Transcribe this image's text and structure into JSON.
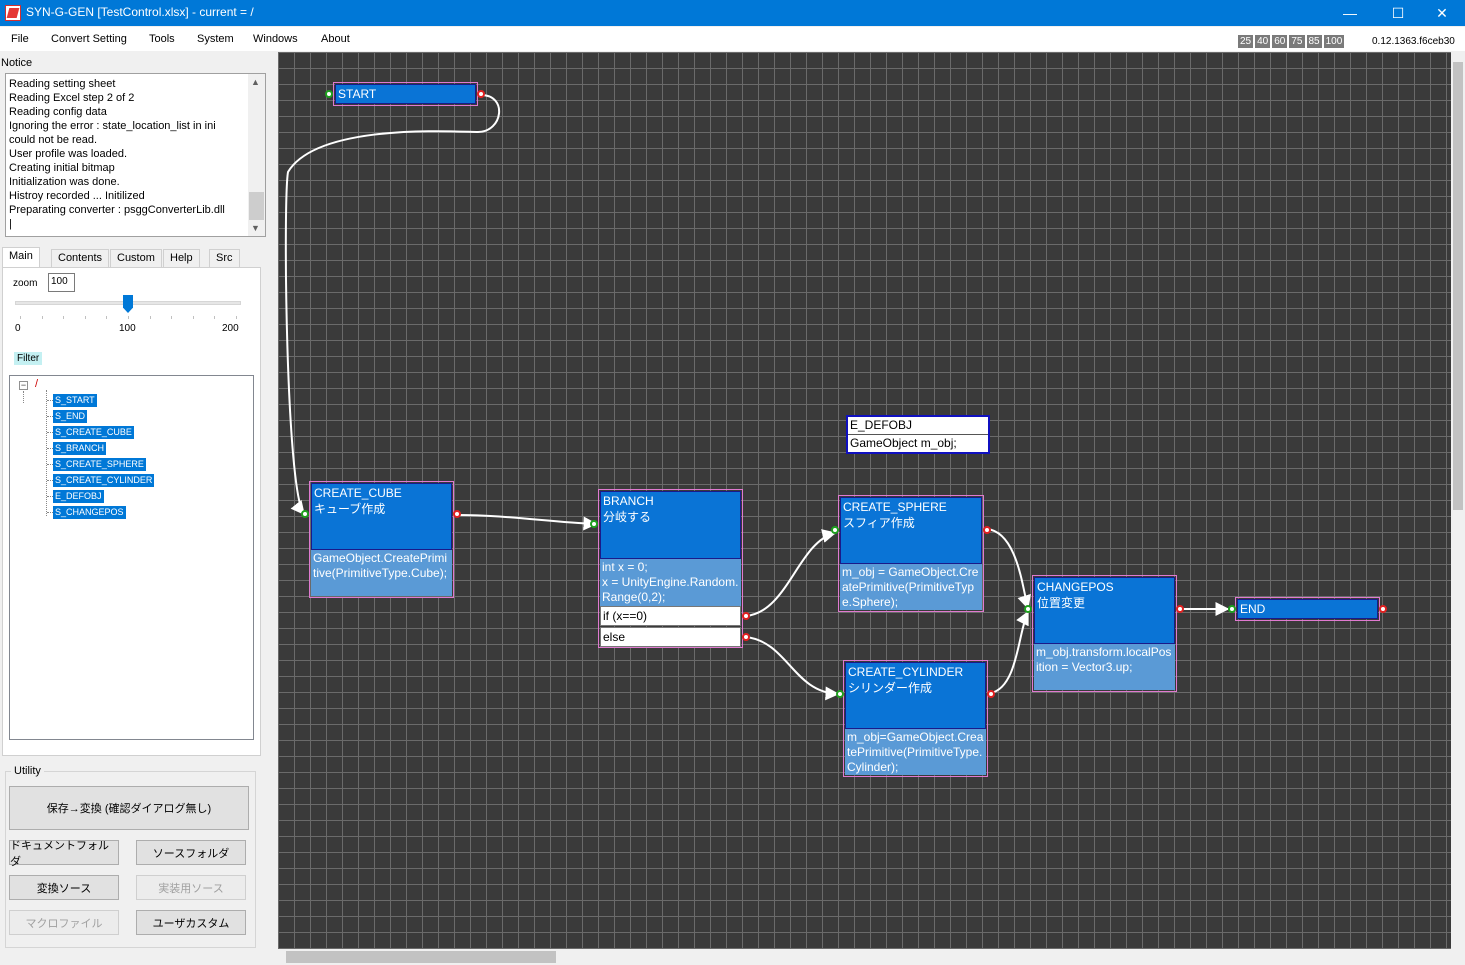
{
  "window": {
    "title": "SYN-G-GEN  [TestControl.xlsx] - current = /",
    "min_icon": "minimize-icon",
    "max_icon": "maximize-icon",
    "close_icon": "close-icon"
  },
  "menu": {
    "items": [
      "File",
      "Convert Setting",
      "Tools",
      "System",
      "Windows",
      "About"
    ]
  },
  "zoom_presets": [
    "25",
    "40",
    "60",
    "75",
    "85",
    "100"
  ],
  "version": "0.12.1363.f6ceb30",
  "notice": {
    "label": "Notice",
    "lines": [
      "Reading setting sheet",
      "Reading Excel step 2 of 2",
      "Reading config data",
      "Ignoring the error : state_location_list in ini",
      "could not be read.",
      "User profile was loaded.",
      "Creating initial bitmap",
      "Initialization was done.",
      "Histroy recorded ... Initilized",
      "Preparating converter : psggConverterLib.dll",
      "|"
    ]
  },
  "tabs": [
    "Main",
    "Contents",
    "Custom",
    "Help",
    "Src"
  ],
  "main_tab": {
    "zoom_label": "zoom",
    "zoom_value": "100",
    "slider_value": 100,
    "slider_min": "0",
    "slider_mid": "100",
    "slider_max": "200",
    "filter_label": "Filter",
    "tree_root": "/",
    "tree_items": [
      "S_START",
      "S_END",
      "S_CREATE_CUBE",
      "S_BRANCH",
      "S_CREATE_SPHERE",
      "S_CREATE_CYLINDER",
      "E_DEFOBJ",
      "S_CHANGEPOS"
    ]
  },
  "utility": {
    "label": "Utility",
    "save_convert": "保存→変換 (確認ダイアログ無し)",
    "doc_folder": "ドキュメントフォルダ",
    "src_folder": "ソースフォルダ",
    "convert_src": "変換ソース",
    "impl_src": "実装用ソース",
    "macro_file": "マクロファイル",
    "user_custom": "ユーザカスタム"
  },
  "nodes": {
    "start": {
      "name": "START"
    },
    "end": {
      "name": "END"
    },
    "create_cube": {
      "name": "CREATE_CUBE",
      "comment": "キューブ作成",
      "code": "GameObject.CreatePrimitive(PrimitiveType.Cube);"
    },
    "branch": {
      "name": "BRANCH",
      "comment": "分岐する",
      "code": "int x = 0;\nx = UnityEngine.Random.Range(0,2);",
      "branch_if": "if (x==0)",
      "branch_else": "else"
    },
    "create_sphere": {
      "name": "CREATE_SPHERE",
      "comment": "スフィア作成",
      "code": "m_obj = GameObject.CreatePrimitive(PrimitiveType.Sphere);"
    },
    "create_cylinder": {
      "name": "CREATE_CYLINDER",
      "comment": "シリンダー作成",
      "code": "m_obj=GameObject.CreatePrimitive(PrimitiveType.Cylinder);"
    },
    "changepos": {
      "name": "CHANGEPOS",
      "comment": "位置変更",
      "code": "m_obj.transform.localPosition = Vector3.up;"
    },
    "defobj": {
      "name": "E_DEFOBJ",
      "code": "GameObject m_obj;"
    }
  }
}
